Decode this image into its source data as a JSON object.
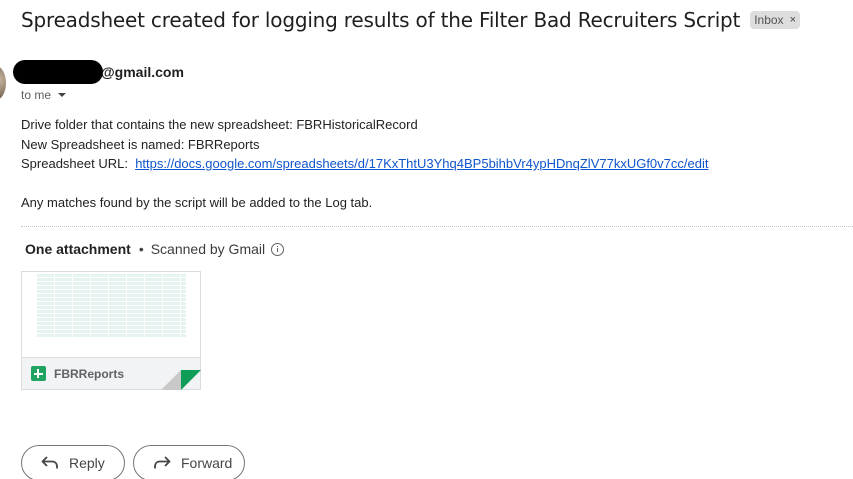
{
  "email": {
    "subject": "Spreadsheet created for logging results of the Filter Bad Recruiters Script",
    "label": "Inbox",
    "label_remove": "×",
    "sender_email": "@gmail.com",
    "recipient": "to me",
    "body": {
      "line1": "Drive folder that contains the new spreadsheet: FBRHistoricalRecord",
      "line2": "New Spreadsheet is named: FBRReports",
      "url_label": "Spreadsheet URL:",
      "url": "https://docs.google.com/spreadsheets/d/17KxThtU3Yhq4BP5bihbVr4ypHDnqZlV77kxUGf0v7cc/edit",
      "line4": "Any matches found by the script will be added to the Log tab."
    }
  },
  "attachments": {
    "count_label": "One attachment",
    "separator": "•",
    "scanned_label": "Scanned by Gmail",
    "items": [
      {
        "name": "FBRReports",
        "icon": "google-sheets-icon"
      }
    ]
  },
  "actions": {
    "reply_label": "Reply",
    "forward_label": "Forward"
  },
  "colors": {
    "link": "#1155cc",
    "sheets_green": "#1ea362",
    "chip_bg": "#dddddd"
  }
}
